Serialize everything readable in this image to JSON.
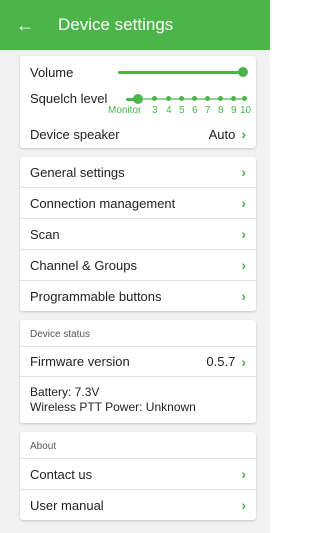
{
  "appbar": {
    "title": "Device settings",
    "back_icon": "arrow-left-icon"
  },
  "controls": {
    "volume": {
      "label": "Volume",
      "level": 1.0
    },
    "squelch": {
      "label": "Squelch level",
      "ticks": [
        "Monitor",
        "3",
        "4",
        "5",
        "6",
        "7",
        "8",
        "9",
        "10"
      ],
      "selected_index": 0
    },
    "speaker": {
      "label": "Device speaker",
      "value": "Auto"
    }
  },
  "menu": [
    {
      "label": "General settings"
    },
    {
      "label": "Connection management"
    },
    {
      "label": "Scan"
    },
    {
      "label": "Channel & Groups"
    },
    {
      "label": "Programmable buttons"
    }
  ],
  "device_status": {
    "header": "Device status",
    "firmware_label": "Firmware version",
    "firmware_value": "0.5.7",
    "battery": "Battery: 7.3V",
    "wireless_ptt": "Wireless PTT Power: Unknown"
  },
  "about": {
    "header": "About",
    "contact": "Contact us",
    "manual": "User manual"
  },
  "colors": {
    "accent": "#4bb54a",
    "background": "#f1f1f1"
  }
}
